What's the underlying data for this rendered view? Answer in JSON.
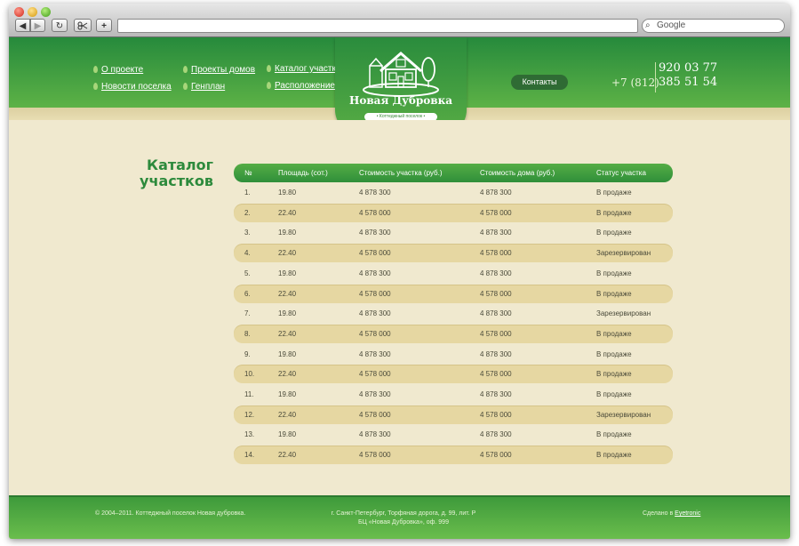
{
  "browser": {
    "search_placeholder": "Google",
    "back_symbol": "◀",
    "forward_symbol": "▶",
    "reload_symbol": "↻",
    "add_symbol": "+"
  },
  "nav": {
    "items": [
      {
        "label": "О проекте"
      },
      {
        "label": "Новости поселка"
      },
      {
        "label": "Проекты домов"
      },
      {
        "label": "Генплан"
      },
      {
        "label": "Каталог участков"
      },
      {
        "label": "Расположение"
      }
    ]
  },
  "logo": {
    "name": "Новая Дубровка",
    "subtitle": "• Коттеджный поселок •"
  },
  "header": {
    "contacts_label": "Контакты",
    "phone_code": "+7 (812)",
    "phone_line1": "920 03 77",
    "phone_line2": "385 51 54"
  },
  "page": {
    "title_line1": "Каталог",
    "title_line2": "участков"
  },
  "table": {
    "headers": [
      "№",
      "Площадь (сот.)",
      "Стоимость участка (руб.)",
      "Стоимость дома (руб.)",
      "Статус участка"
    ],
    "rows": [
      [
        "1.",
        "19.80",
        "4 878 300",
        "4 878 300",
        "В продаже"
      ],
      [
        "2.",
        "22.40",
        "4 578 000",
        "4 578 000",
        "В продаже"
      ],
      [
        "3.",
        "19.80",
        "4 878 300",
        "4 878 300",
        "В продаже"
      ],
      [
        "4.",
        "22.40",
        "4 578 000",
        "4 578 000",
        "Зарезервирован"
      ],
      [
        "5.",
        "19.80",
        "4 878 300",
        "4 878 300",
        "В продаже"
      ],
      [
        "6.",
        "22.40",
        "4 578 000",
        "4 578 000",
        "В продаже"
      ],
      [
        "7.",
        "19.80",
        "4 878 300",
        "4 878 300",
        "Зарезервирован"
      ],
      [
        "8.",
        "22.40",
        "4 578 000",
        "4 578 000",
        "В продаже"
      ],
      [
        "9.",
        "19.80",
        "4 878 300",
        "4 878 300",
        "В продаже"
      ],
      [
        "10.",
        "22.40",
        "4 578 000",
        "4 578 000",
        "В продаже"
      ],
      [
        "11.",
        "19.80",
        "4 878 300",
        "4 878 300",
        "В продаже"
      ],
      [
        "12.",
        "22.40",
        "4 578 000",
        "4 578 000",
        "Зарезервирован"
      ],
      [
        "13.",
        "19.80",
        "4 878 300",
        "4 878 300",
        "В продаже"
      ],
      [
        "14.",
        "22.40",
        "4 578 000",
        "4 578 000",
        "В продаже"
      ]
    ]
  },
  "footer": {
    "copyright": "© 2004–2011. Коттеджный поселок Новая дубровка.",
    "address_line1": "г. Санкт-Петербург, Торфяная дорога, д. 99, лит. Р",
    "address_line2": "БЦ «Новая Дубровка», оф. 999",
    "made_by_prefix": "Сделано в",
    "made_by_link": "Eyetronic"
  },
  "colors": {
    "header_green": "#268a3c",
    "light_green": "#5db246",
    "paper": "#f0e9cf",
    "row_alt": "#e6d7a2",
    "title_green": "#2d8a3c"
  }
}
